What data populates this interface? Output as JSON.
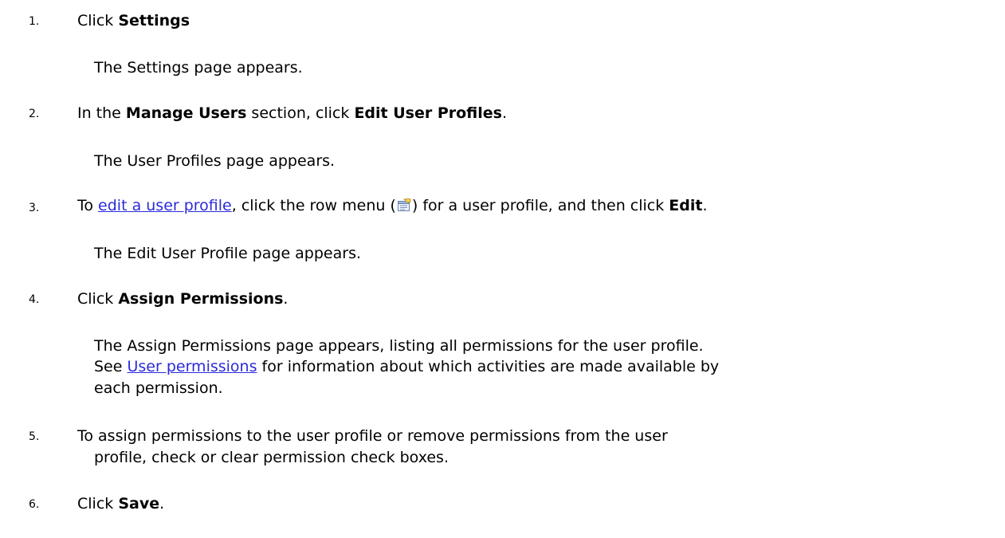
{
  "steps": [
    {
      "number": "1.",
      "prefix": "Click ",
      "bold": "Settings",
      "result": "The Settings page appears."
    },
    {
      "number": "2.",
      "prefix": "In the ",
      "bold1": "Manage Users",
      "middle": " section, click ",
      "bold2": "Edit User Profiles",
      "suffix": ".",
      "result": "The User Profiles page appears."
    },
    {
      "number": "3.",
      "prefix": "To ",
      "link": "edit a user profile",
      "middle1": ", click the row menu (",
      "icon": "row-menu-icon",
      "middle2": ") for a user profile, and then click ",
      "bold": "Edit",
      "suffix": ".",
      "result": "The Edit User Profile page appears."
    },
    {
      "number": "4.",
      "prefix": "Click ",
      "bold": "Assign Permissions",
      "suffix": ".",
      "result_line1": "The Assign Permissions page appears, listing all permissions for the user profile.",
      "result_line2_prefix": "See ",
      "result_line2_link": "User permissions",
      "result_line2_suffix": " for information about which activities are made available by",
      "result_line3": "each permission."
    },
    {
      "number": "5.",
      "line1": "To assign permissions to the user profile or remove permissions from the user",
      "line2": "profile, check or clear permission check boxes."
    },
    {
      "number": "6.",
      "prefix": "Click ",
      "bold": "Save",
      "suffix": "."
    }
  ],
  "colors": {
    "text": "#000000",
    "link": "#2b2bd9"
  }
}
